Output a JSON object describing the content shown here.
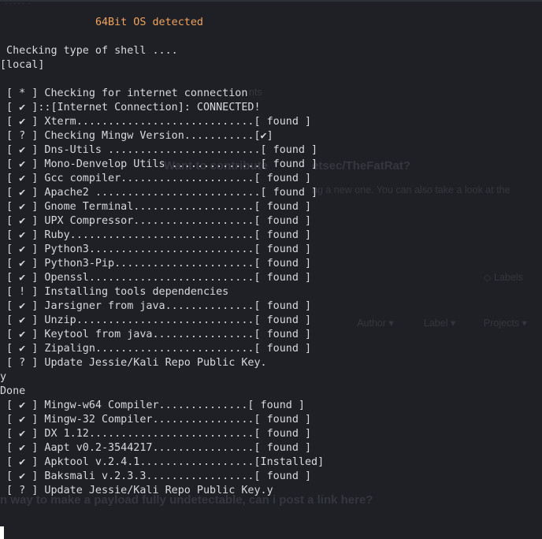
{
  "ghost_text": {
    "top_fragment": "- - - - -  -",
    "snip_1": "nts",
    "snip_2": "Want to contribute",
    "snip_3": "etsec/TheFatRat?",
    "snip_4": "ng a new one. You can also take a look at the",
    "snip_5": "Labels",
    "snip_6": "Author",
    "snip_7": "Label",
    "snip_8": "Projects",
    "snip_9": "n way to make a payload fully undetectable, can i post a link here?"
  },
  "terminal": {
    "lines": [
      {
        "pad": "               ",
        "text": "64Bit OS detected",
        "style": "orange"
      },
      {
        "pad": "",
        "text": "",
        "style": "plain"
      },
      {
        "pad": "",
        "text": " Checking type of shell ....",
        "style": "plain"
      },
      {
        "pad": "",
        "text": "[local]",
        "style": "plain"
      },
      {
        "pad": "",
        "text": "",
        "style": "plain"
      },
      {
        "pad": "",
        "text": " [ * ] Checking for internet connection",
        "style": "plain"
      },
      {
        "pad": "",
        "text": " [ ✔ ]::[Internet Connection]: CONNECTED!",
        "style": "plain"
      },
      {
        "pad": "",
        "text": " [ ✔ ] Xterm............................[ found ]",
        "style": "plain"
      },
      {
        "pad": "",
        "text": " [ ? ] Checking Mingw Version...........[✔]",
        "style": "plain"
      },
      {
        "pad": "",
        "text": " [ ✔ ] Dns-Utils ........................[ found ]",
        "style": "plain"
      },
      {
        "pad": "",
        "text": " [ ✔ ] Mono-Denvelop Utils ..............[ found ]",
        "style": "plain"
      },
      {
        "pad": "",
        "text": " [ ✔ ] Gcc compiler.....................[ found ]",
        "style": "plain"
      },
      {
        "pad": "",
        "text": " [ ✔ ] Apache2 ..........................[ found ]",
        "style": "plain"
      },
      {
        "pad": "",
        "text": " [ ✔ ] Gnome Terminal...................[ found ]",
        "style": "plain"
      },
      {
        "pad": "",
        "text": " [ ✔ ] UPX Compressor...................[ found ]",
        "style": "plain"
      },
      {
        "pad": "",
        "text": " [ ✔ ] Ruby.............................[ found ]",
        "style": "plain"
      },
      {
        "pad": "",
        "text": " [ ✔ ] Python3..........................[ found ]",
        "style": "plain"
      },
      {
        "pad": "",
        "text": " [ ✔ ] Python3-Pip......................[ found ]",
        "style": "plain"
      },
      {
        "pad": "",
        "text": " [ ✔ ] Openssl..........................[ found ]",
        "style": "plain"
      },
      {
        "pad": "",
        "text": " [ ! ] Installing tools dependencies",
        "style": "plain"
      },
      {
        "pad": "",
        "text": " [ ✔ ] Jarsigner from java..............[ found ]",
        "style": "plain"
      },
      {
        "pad": "",
        "text": " [ ✔ ] Unzip............................[ found ]",
        "style": "plain"
      },
      {
        "pad": "",
        "text": " [ ✔ ] Keytool from java................[ found ]",
        "style": "plain"
      },
      {
        "pad": "",
        "text": " [ ✔ ] Zipalign.........................[ found ]",
        "style": "plain"
      },
      {
        "pad": "",
        "text": " [ ? ] Update Jessie/Kali Repo Public Key.",
        "style": "plain"
      },
      {
        "pad": "",
        "text": "y",
        "style": "plain"
      },
      {
        "pad": "",
        "text": "Done",
        "style": "plain"
      },
      {
        "pad": "",
        "text": " [ ✔ ] Mingw-w64 Compiler..............[ found ]",
        "style": "plain"
      },
      {
        "pad": "",
        "text": " [ ✔ ] Mingw-32 Compiler................[ found ]",
        "style": "plain"
      },
      {
        "pad": "",
        "text": " [ ✔ ] DX 1.12..........................[ found ]",
        "style": "plain"
      },
      {
        "pad": "",
        "text": " [ ✔ ] Aapt v0.2-3544217................[ found ]",
        "style": "plain"
      },
      {
        "pad": "",
        "text": " [ ✔ ] Apktool v.2.4.1..................[Installed]",
        "style": "plain"
      },
      {
        "pad": "",
        "text": " [ ✔ ] Baksmali v.2.3.3.................[ found ]",
        "style": "plain"
      },
      {
        "pad": "",
        "text": " [ ? ] Update Jessie/Kali Repo Public Key.y",
        "style": "plain"
      }
    ]
  },
  "colors": {
    "background": "#1f2025",
    "text": "#d7d9de",
    "highlight": "#f0a35e",
    "cursor": "#ffffff"
  }
}
